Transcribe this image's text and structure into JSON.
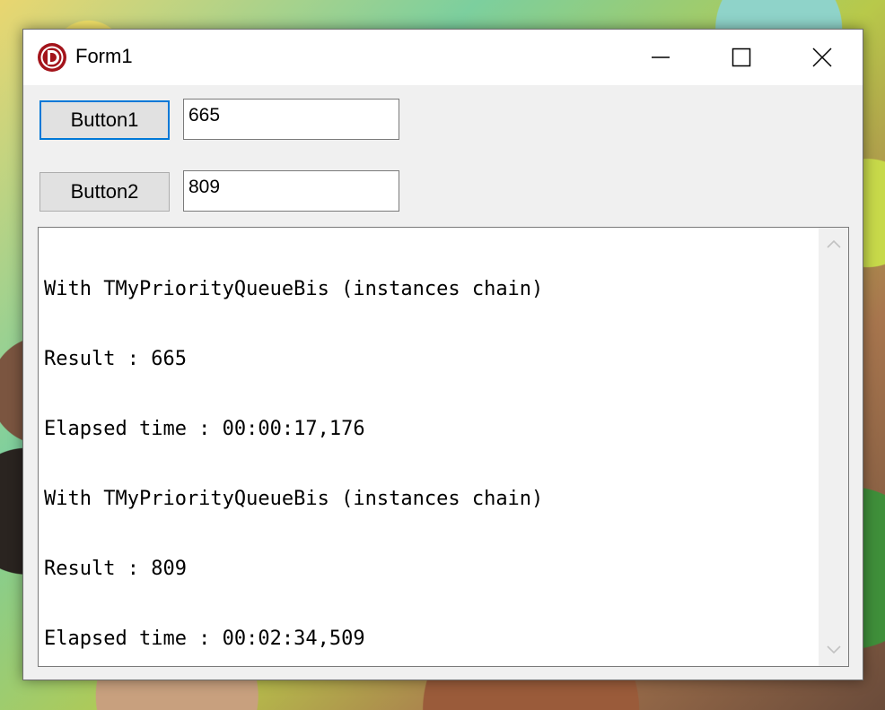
{
  "window": {
    "title": "Form1",
    "app_icon": "delphi-logo-icon",
    "controls": [
      "minimize-icon",
      "maximize-icon",
      "close-icon"
    ]
  },
  "button1": {
    "label": "Button1",
    "focused": true
  },
  "edit1": {
    "value": "665"
  },
  "button2": {
    "label": "Button2",
    "focused": false
  },
  "edit2": {
    "value": "809"
  },
  "memo": {
    "lines": [
      "With TMyPriorityQueueBis (instances chain)",
      "Result : 665",
      "Elapsed time : 00:00:17,176",
      "With TMyPriorityQueueBis (instances chain)",
      "Result : 809",
      "Elapsed time : 00:02:34,509"
    ]
  },
  "colors": {
    "focus_border": "#0078d7",
    "icon_red": "#a3141b"
  }
}
